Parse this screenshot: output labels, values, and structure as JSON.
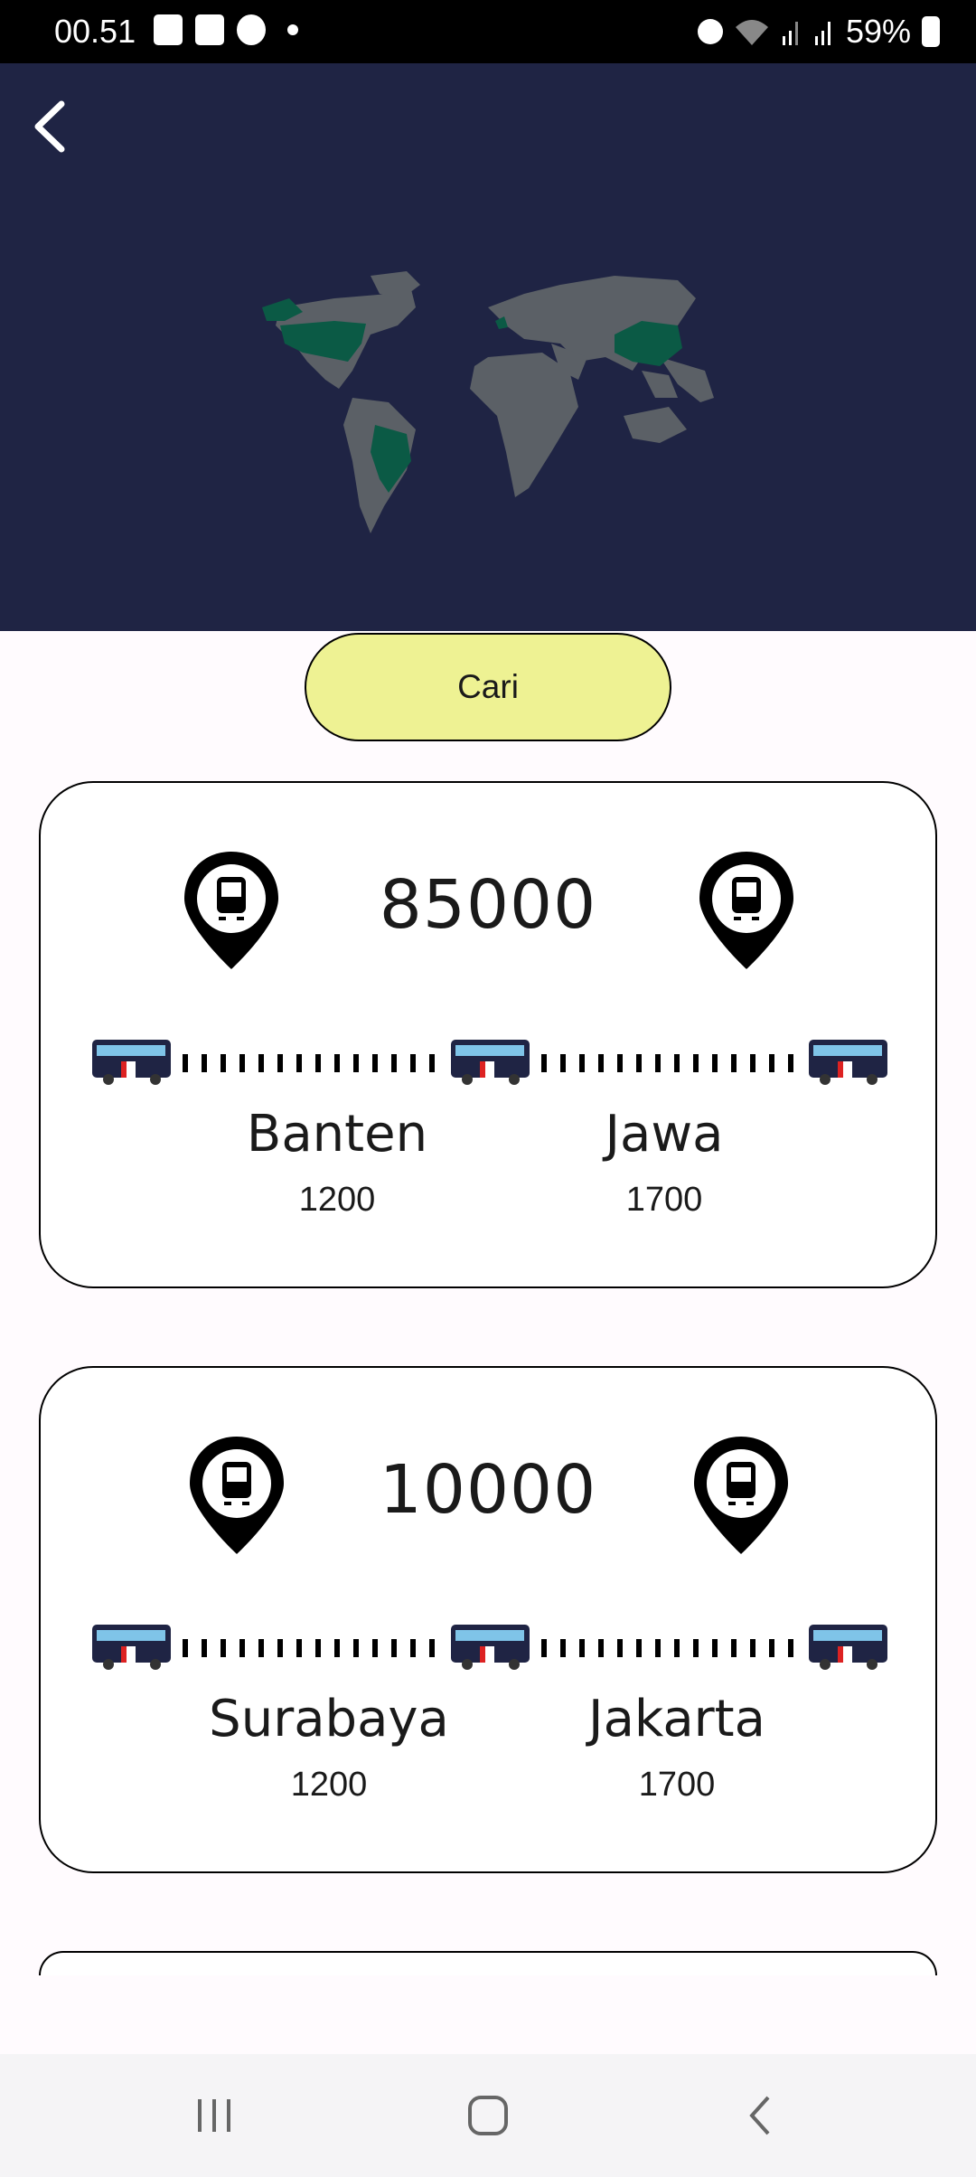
{
  "status_bar": {
    "time": "00.51",
    "battery": "59%",
    "left_icons": [
      "gallery-icon",
      "shopee-icon",
      "whatsapp-icon",
      "dot-icon"
    ],
    "right_icons": [
      "alarm-icon",
      "wifi-icon",
      "signal-icon",
      "signal-icon",
      "battery-charging-icon"
    ]
  },
  "header": {
    "back_icon": "chevron-left-icon",
    "map_highlight_color": "#0b5a45",
    "map_land_color": "#5b6066",
    "background": "#1f2444"
  },
  "search_button": {
    "label": "Cari",
    "color": "#eef293"
  },
  "routes": [
    {
      "price": "85000",
      "origin": "Banten",
      "origin_value": "1200",
      "destination": "Jawa",
      "destination_value": "1700"
    },
    {
      "price": "10000",
      "origin": "Surabaya",
      "origin_value": "1200",
      "destination": "Jakarta",
      "destination_value": "1700"
    }
  ],
  "nav_bar": {
    "buttons": [
      "recent-apps",
      "home",
      "back"
    ]
  }
}
